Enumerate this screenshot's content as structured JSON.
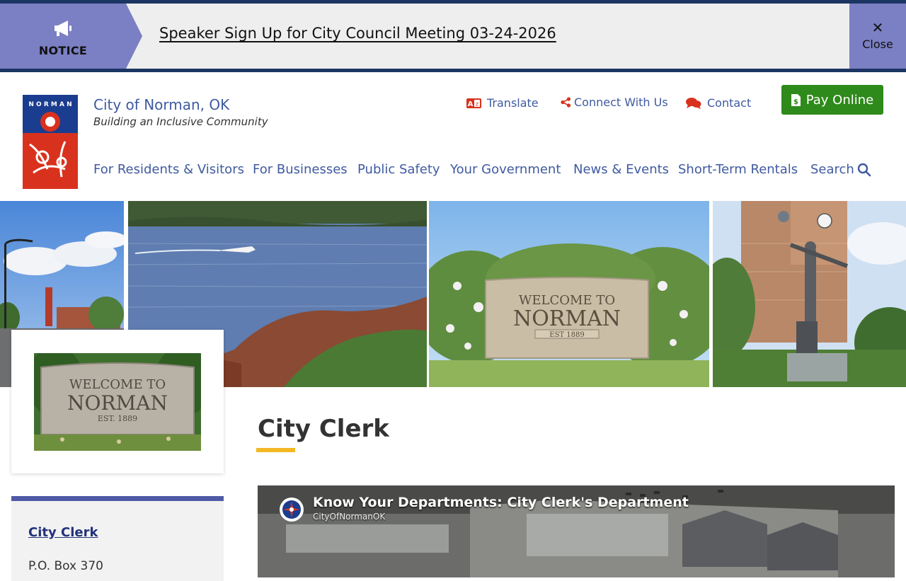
{
  "notice": {
    "label": "NOTICE",
    "icon": "megaphone-icon",
    "link_text": "Speaker Sign Up for City Council Meeting 03-24-2026",
    "close_label": "Close"
  },
  "header": {
    "site_name": "City of Norman, OK",
    "tagline": "Building an Inclusive Community",
    "logo_text": "NORMAN"
  },
  "utility": {
    "translate": "Translate",
    "connect": "Connect With Us",
    "contact": "Contact",
    "pay": "Pay Online"
  },
  "nav": {
    "items": [
      "For Residents & Visitors",
      "For Businesses",
      "Public Safety",
      "Your Government",
      "News & Events",
      "Short-Term Rentals"
    ],
    "search": "Search"
  },
  "page": {
    "title": "City Clerk"
  },
  "sidebar": {
    "contact_title": "City Clerk ",
    "address_line": "P.O. Box 370"
  },
  "video": {
    "title": "Know Your Departments: City Clerk's Department",
    "channel": "CityOfNormanOK"
  },
  "colors": {
    "navy": "#1c3563",
    "accent": "#7b7fc3",
    "link": "#3f5aa0",
    "pay_green": "#2e8a1a",
    "title_rule": "#f4b824"
  }
}
